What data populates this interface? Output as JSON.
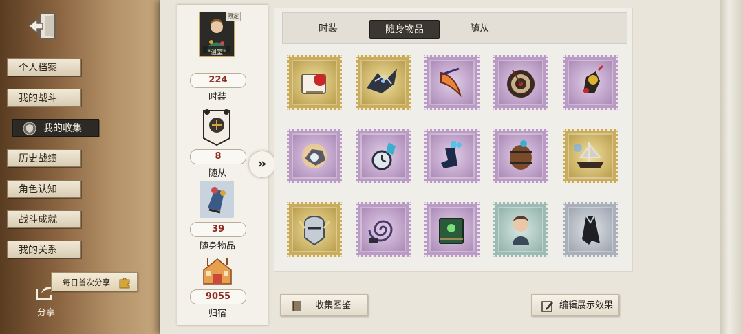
{
  "sidebar": {
    "items": [
      {
        "label": "个人档案"
      },
      {
        "label": "我的战斗"
      },
      {
        "label": "我的收集"
      },
      {
        "label": "历史战绩"
      },
      {
        "label": "角色认知"
      },
      {
        "label": "战斗成就"
      },
      {
        "label": "我的关系"
      }
    ],
    "daily_share": "每日首次分享",
    "share_label": "分享"
  },
  "summary": {
    "costume": {
      "badge": "限定",
      "name_tag": "\"温室\"",
      "count": "224",
      "label": "时装"
    },
    "follower": {
      "count": "8",
      "label": "随从"
    },
    "accessory": {
      "count": "39",
      "label": "随身物品"
    },
    "home": {
      "count": "9055",
      "label": "归宿"
    }
  },
  "tabs": [
    {
      "label": "时装"
    },
    {
      "label": "随身物品",
      "active": true
    },
    {
      "label": "随从"
    }
  ],
  "grid": {
    "items": [
      {
        "tier": "gold",
        "icon": "rose-box-icon"
      },
      {
        "tier": "gold",
        "icon": "crystal-bird-icon"
      },
      {
        "tier": "purple",
        "icon": "boomerang-icon"
      },
      {
        "tier": "purple",
        "icon": "dartboard-icon"
      },
      {
        "tier": "purple",
        "icon": "mechanical-gadget-icon"
      },
      {
        "tier": "purple",
        "icon": "glowing-orb-icon"
      },
      {
        "tier": "purple",
        "icon": "clock-flask-icon"
      },
      {
        "tier": "purple",
        "icon": "potion-boot-icon"
      },
      {
        "tier": "purple",
        "icon": "barrel-icon"
      },
      {
        "tier": "gold",
        "icon": "ship-icon"
      },
      {
        "tier": "gold",
        "icon": "knight-helmet-icon"
      },
      {
        "tier": "purple",
        "icon": "spiral-icon"
      },
      {
        "tier": "purple",
        "icon": "green-book-icon"
      },
      {
        "tier": "teal",
        "icon": "doll-icon"
      },
      {
        "tier": "gray",
        "icon": "cloak-icon"
      }
    ]
  },
  "buttons": {
    "collection_guide": "收集图鉴",
    "edit_display": "编辑展示效果"
  },
  "colors": {
    "active_tab": "#3a3733",
    "count_text": "#8e2a20",
    "paper": "#e9e5da"
  }
}
